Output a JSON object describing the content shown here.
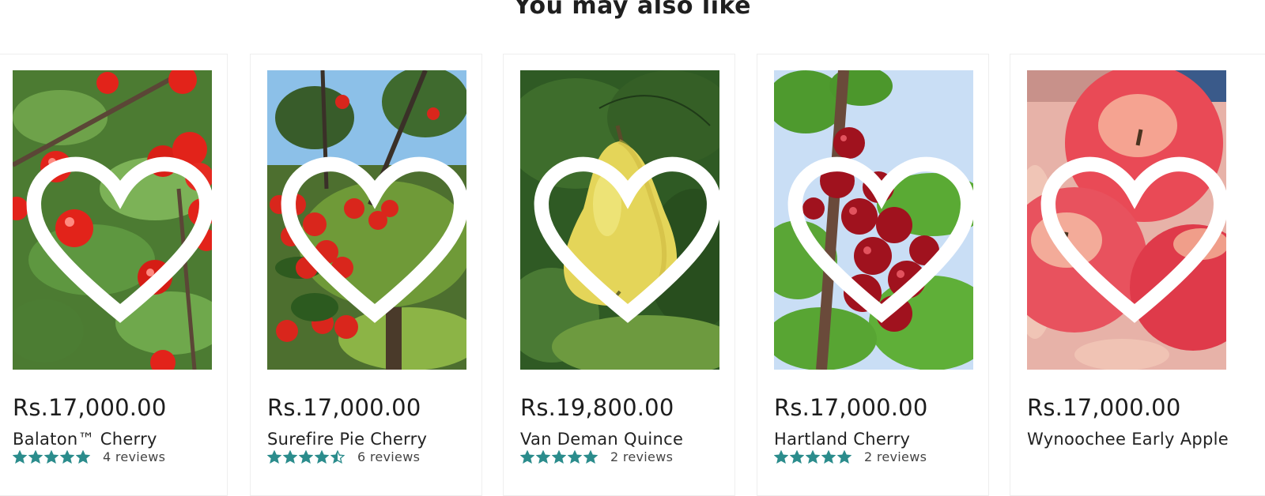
{
  "section": {
    "heading": "You may also like"
  },
  "colors": {
    "star": "#2b8c8c",
    "text": "#1d1d1d",
    "card_border": "#eeeeee"
  },
  "products": [
    {
      "price": "Rs.17,000.00",
      "title": "Balaton™ Cherry",
      "rating": 5,
      "reviews": "4 reviews",
      "image": "cherry-tree-photo",
      "wishlist_icon": "heart-outline-icon"
    },
    {
      "price": "Rs.17,000.00",
      "title": "Surefire Pie Cherry",
      "rating": 4.5,
      "reviews": "6 reviews",
      "image": "cherry-branch-photo",
      "wishlist_icon": "heart-outline-icon"
    },
    {
      "price": "Rs.19,800.00",
      "title": "Van Deman Quince",
      "rating": 5,
      "reviews": "2 reviews",
      "image": "quince-fruit-photo",
      "wishlist_icon": "heart-outline-icon"
    },
    {
      "price": "Rs.17,000.00",
      "title": "Hartland Cherry",
      "rating": 5,
      "reviews": "2 reviews",
      "image": "cherry-cluster-photo",
      "wishlist_icon": "heart-outline-icon"
    },
    {
      "price": "Rs.17,000.00",
      "title": "Wynoochee Early Apple",
      "rating": null,
      "reviews": "",
      "image": "red-apples-photo",
      "wishlist_icon": "heart-outline-icon"
    }
  ]
}
